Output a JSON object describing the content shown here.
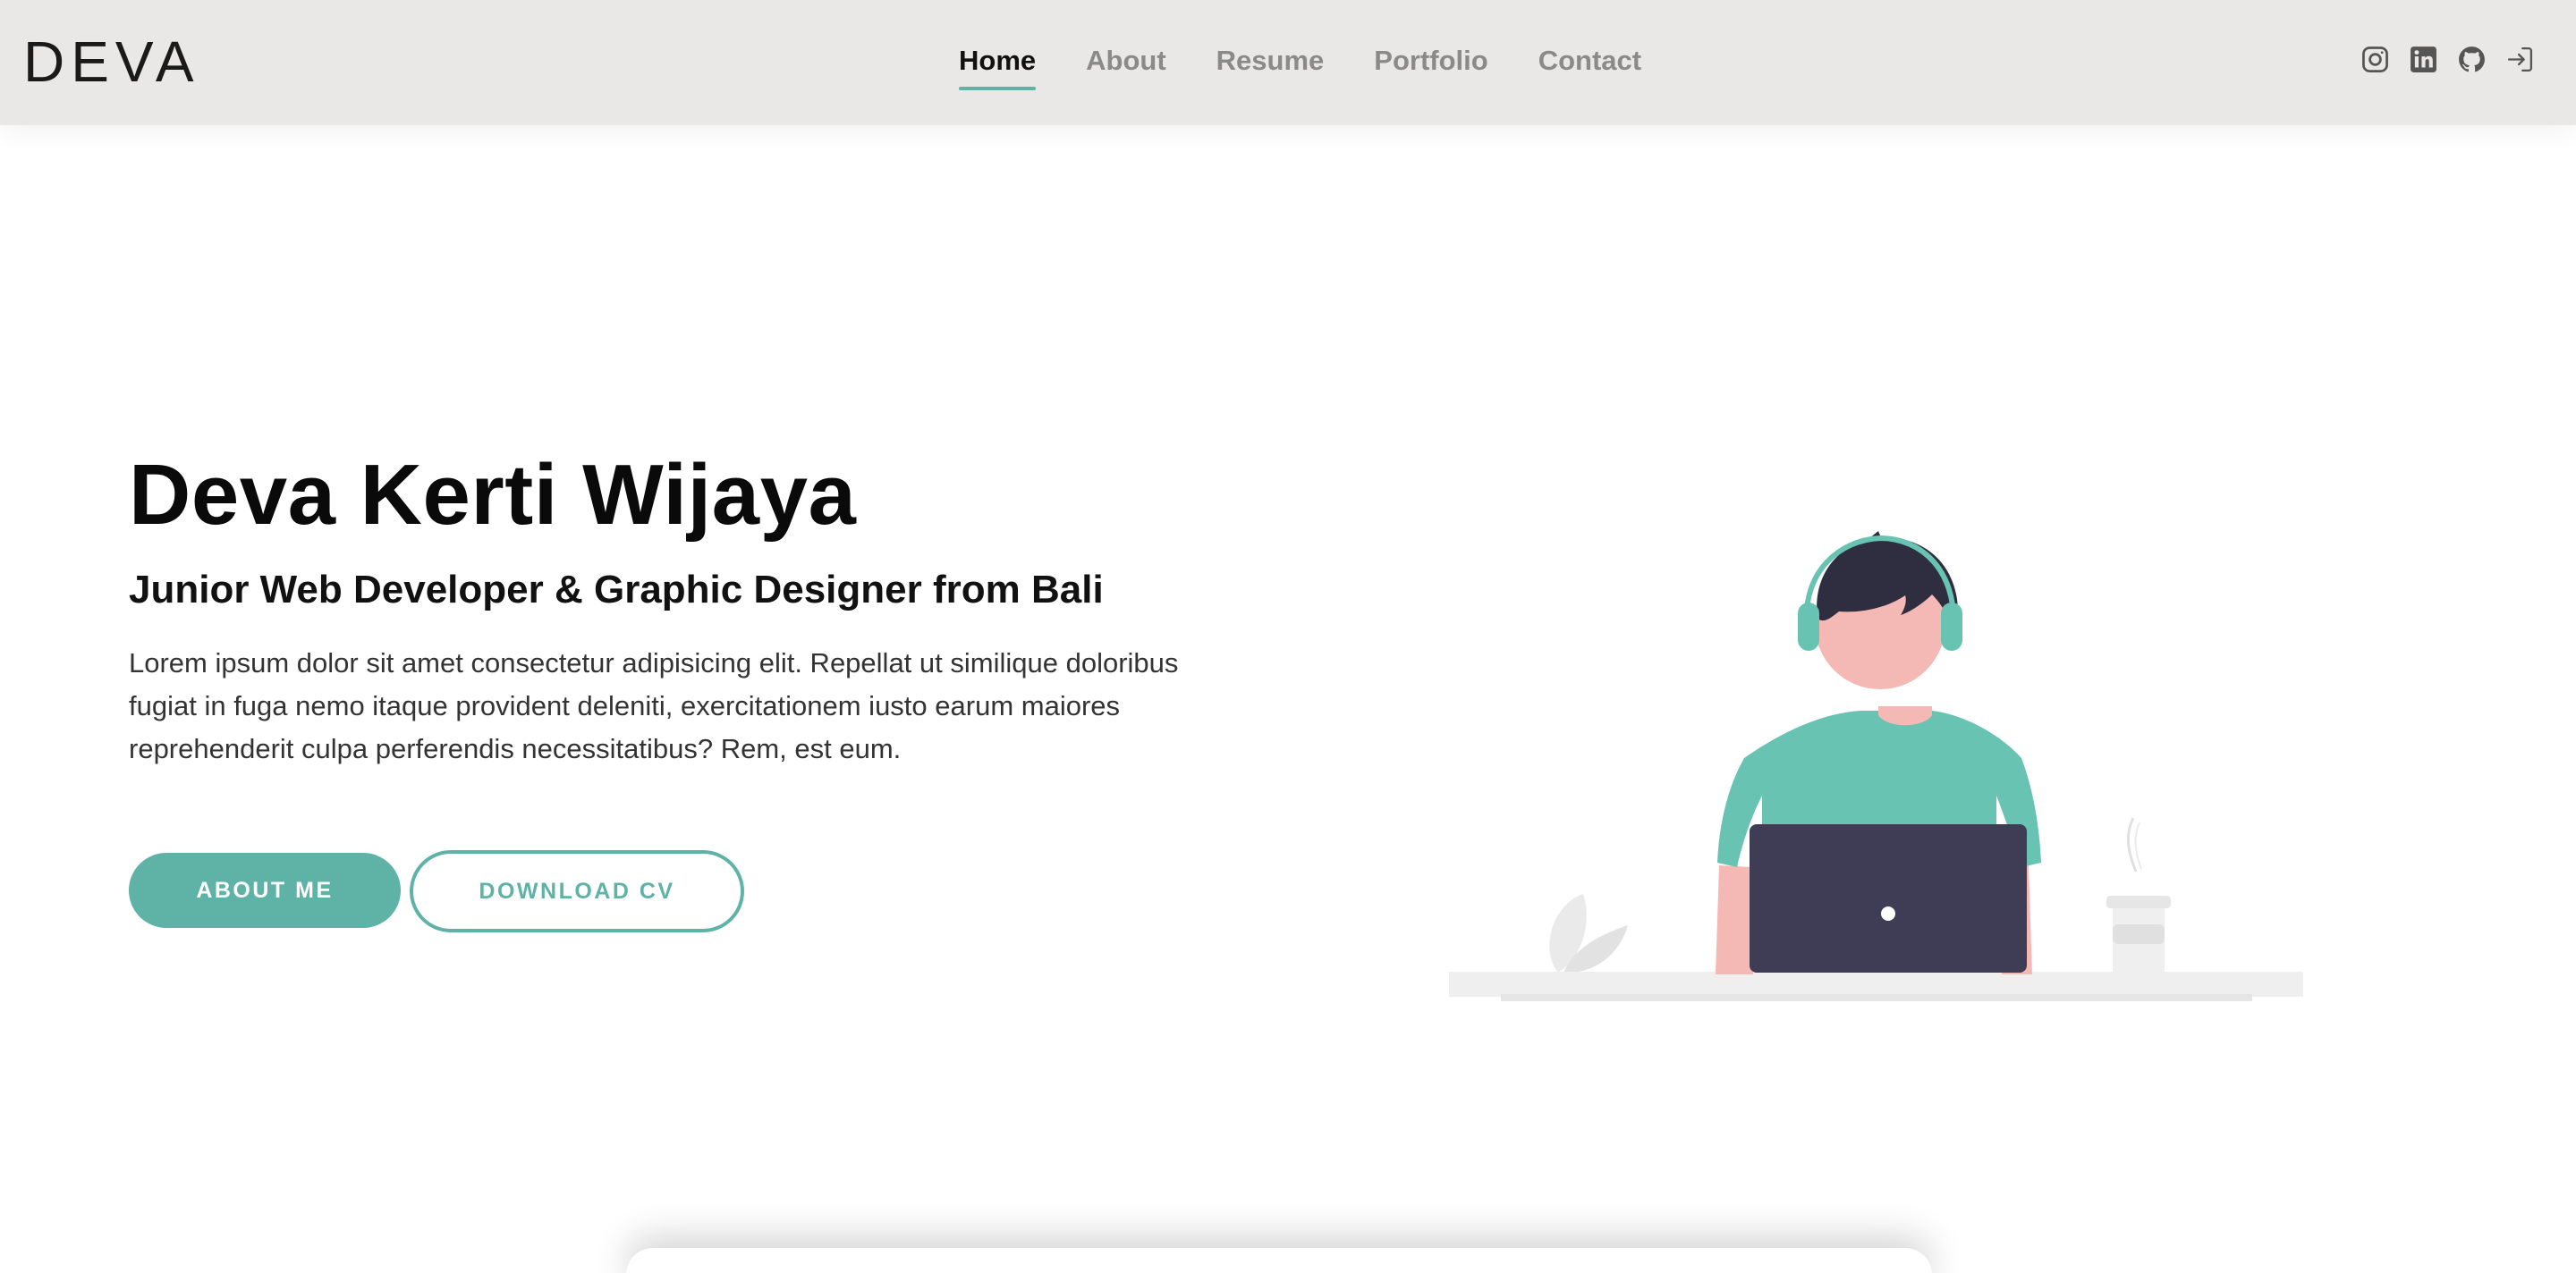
{
  "navbar": {
    "brand": "DEVA",
    "links": [
      {
        "label": "Home",
        "active": true
      },
      {
        "label": "About",
        "active": false
      },
      {
        "label": "Resume",
        "active": false
      },
      {
        "label": "Portfolio",
        "active": false
      },
      {
        "label": "Contact",
        "active": false
      }
    ],
    "icons": [
      "instagram-icon",
      "linkedin-icon",
      "github-icon",
      "login-icon"
    ]
  },
  "hero": {
    "name": "Deva Kerti Wijaya",
    "subtitle": "Junior Web Developer & Graphic Designer from Bali",
    "description": "Lorem ipsum dolor sit amet consectetur adipisicing elit. Repellat ut similique doloribus fugiat in fuga nemo itaque provident deleniti, exercitationem iusto earum maiores reprehenderit culpa perferendis necessitatibus? Rem, est eum.",
    "primary_button": "ABOUT ME",
    "secondary_button": "DOWNLOAD CV"
  },
  "colors": {
    "accent": "#5fb3a6",
    "navbar_bg": "#e9e8e6",
    "laptop": "#3f3d56",
    "skin": "#f4b9b4",
    "hair": "#2f2e41"
  }
}
